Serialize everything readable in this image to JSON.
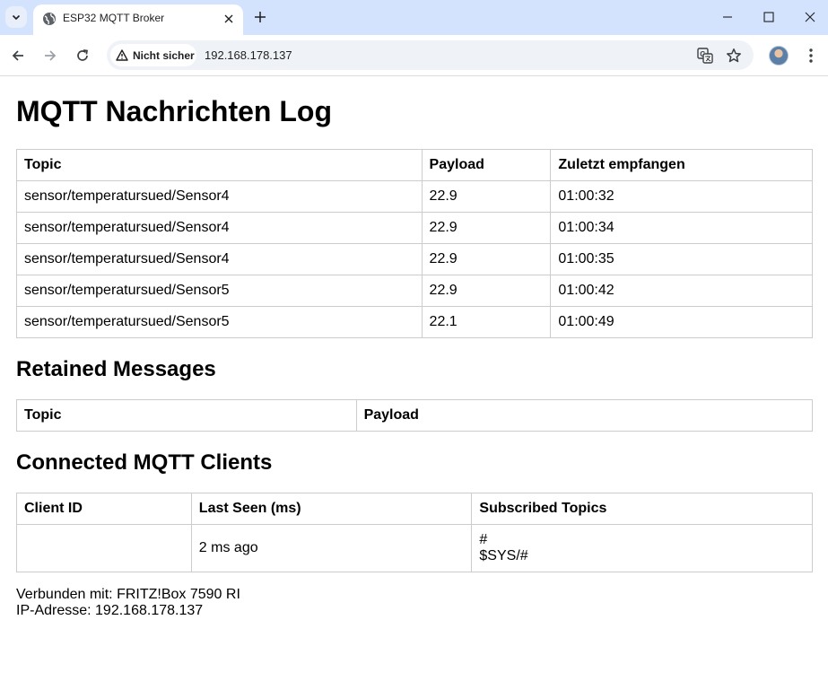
{
  "browser": {
    "tab_title": "ESP32 MQTT Broker",
    "security_label": "Nicht sicher",
    "url": "192.168.178.137"
  },
  "page": {
    "title": "MQTT Nachrichten Log",
    "log_table": {
      "headers": [
        "Topic",
        "Payload",
        "Zuletzt empfangen"
      ],
      "rows": [
        [
          "sensor/temperatursued/Sensor4",
          "22.9",
          "01:00:32"
        ],
        [
          "sensor/temperatursued/Sensor4",
          "22.9",
          "01:00:34"
        ],
        [
          "sensor/temperatursued/Sensor4",
          "22.9",
          "01:00:35"
        ],
        [
          "sensor/temperatursued/Sensor5",
          "22.9",
          "01:00:42"
        ],
        [
          "sensor/temperatursued/Sensor5",
          "22.1",
          "01:00:49"
        ]
      ]
    },
    "retained": {
      "heading": "Retained Messages",
      "headers": [
        "Topic",
        "Payload"
      ]
    },
    "clients": {
      "heading": "Connected MQTT Clients",
      "headers": [
        "Client ID",
        "Last Seen (ms)",
        "Subscribed Topics"
      ],
      "rows": [
        {
          "client_id": "",
          "last_seen": "2 ms ago",
          "topics": [
            "#",
            "$SYS/#"
          ]
        }
      ]
    },
    "footer": {
      "connected": "Verbunden mit: FRITZ!Box 7590 RI",
      "ip": "IP-Adresse: 192.168.178.137"
    }
  }
}
